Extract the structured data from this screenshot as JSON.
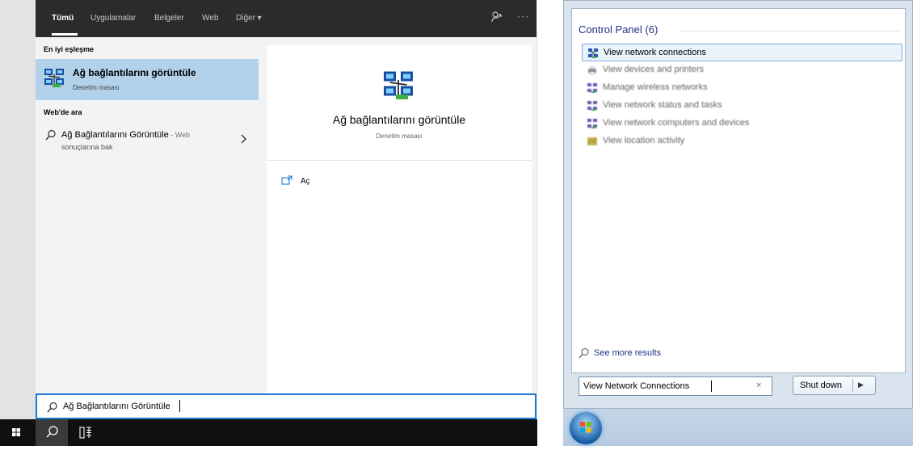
{
  "win10": {
    "tabs": [
      "Tümü",
      "Uygulamalar",
      "Belgeler",
      "Web",
      "Diğer ▾"
    ],
    "sections": {
      "best_match": "En iyi eşleşme",
      "web_search": "Web'de ara"
    },
    "best_match": {
      "title": "Ağ bağlantılarını görüntüle",
      "subtitle": "Denetim masası"
    },
    "web_result": {
      "title": "Ağ Bağlantılarını Görüntüle",
      "suffix": " - Web",
      "subtitle": "sonuçlarına bak"
    },
    "preview": {
      "title": "Ağ bağlantılarını görüntüle",
      "subtitle": "Denetim masası",
      "open_label": "Aç"
    },
    "search_text": "Ağ Bağlantılarını Görüntüle",
    "more_glyph": "···"
  },
  "win7": {
    "header": "Control Panel (6)",
    "items": [
      {
        "label": "View network connections"
      },
      {
        "label": "View devices and printers"
      },
      {
        "label": "Manage wireless networks"
      },
      {
        "label": "View network status and tasks"
      },
      {
        "label": "View network computers and devices"
      },
      {
        "label": "View location activity"
      }
    ],
    "see_more": "See more results",
    "search_text": "View Network Connections",
    "clear_glyph": "×",
    "shutdown_label": "Shut down",
    "shutdown_arrow": "▶"
  },
  "colors": {
    "win10_selected": "#b1d2ea",
    "win10_accent": "#1978d2",
    "win7_link": "#1e3287"
  }
}
